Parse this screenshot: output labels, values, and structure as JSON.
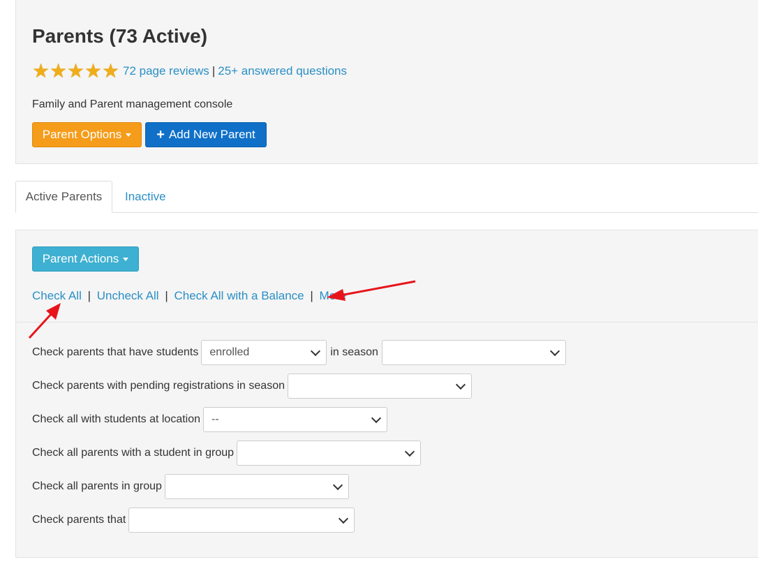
{
  "header": {
    "title": "Parents (73 Active)",
    "stars": [
      "★",
      "★",
      "★",
      "★",
      "★"
    ],
    "reviews_link": "72 page reviews",
    "separator": "|",
    "questions_link": "25+ answered questions",
    "subtitle": "Family and Parent management console",
    "parent_options_label": "Parent Options",
    "add_parent_label": "Add New Parent",
    "add_parent_icon": "+"
  },
  "tabs": [
    {
      "label": "Active Parents",
      "active": true
    },
    {
      "label": "Inactive",
      "active": false
    }
  ],
  "actions": {
    "parent_actions_label": "Parent Actions",
    "links": [
      "Check All",
      "Uncheck All",
      "Check All with a Balance",
      "More"
    ],
    "separator": "|"
  },
  "filters": {
    "students": {
      "label": "Check parents that have students",
      "status_value": "enrolled",
      "middle_label": "in season",
      "season_value": ""
    },
    "pending": {
      "label": "Check parents with pending registrations in season",
      "value": ""
    },
    "location": {
      "label": "Check all with students at location",
      "value": "--"
    },
    "student_group": {
      "label": "Check all parents with a student in group",
      "value": ""
    },
    "group": {
      "label": "Check all parents in group",
      "value": ""
    },
    "that": {
      "label": "Check parents that",
      "value": ""
    }
  },
  "colors": {
    "orange_button": "#f59c1a",
    "blue_button": "#1070c8",
    "teal_button": "#3eb0d1",
    "link": "#2a8fc5",
    "star": "#f0ad1a",
    "annotation_arrow": "#e8141b"
  }
}
